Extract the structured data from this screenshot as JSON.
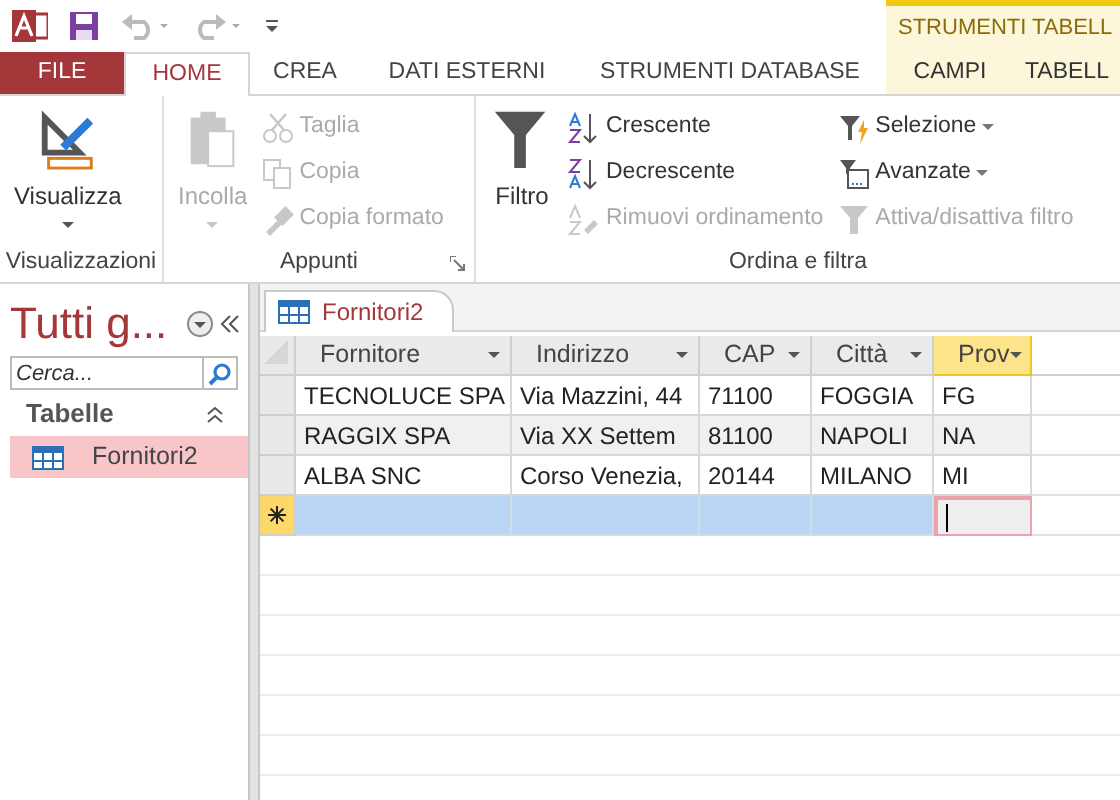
{
  "quick_access": {
    "undo_enabled": false,
    "redo_enabled": false
  },
  "contextual_group": {
    "label": "STRUMENTI TABELL"
  },
  "tabs": [
    {
      "label": "FILE",
      "kind": "file",
      "selected": false
    },
    {
      "label": "HOME",
      "kind": "tab",
      "selected": true
    },
    {
      "label": "CREA",
      "kind": "tab",
      "selected": false
    },
    {
      "label": "DATI ESTERNI",
      "kind": "tab",
      "selected": false
    },
    {
      "label": "STRUMENTI DATABASE",
      "kind": "tab",
      "selected": false
    },
    {
      "label": "CAMPI",
      "kind": "context",
      "selected": false
    },
    {
      "label": "TABELL",
      "kind": "context",
      "selected": false
    }
  ],
  "ribbon": {
    "groups": [
      {
        "label": "Visualizzazioni",
        "large": [
          {
            "label": "Visualizza",
            "disabled": false,
            "dropdown": true
          }
        ],
        "launcher": false
      },
      {
        "label": "Appunti",
        "large": [
          {
            "label": "Incolla",
            "disabled": true,
            "dropdown": true
          }
        ],
        "columns": [
          [
            {
              "label": "Taglia",
              "disabled": true,
              "dropdown": false
            },
            {
              "label": "Copia",
              "disabled": true,
              "dropdown": false
            },
            {
              "label": "Copia formato",
              "disabled": true,
              "dropdown": false
            }
          ]
        ],
        "launcher": true
      },
      {
        "label": "Ordina e filtra",
        "large": [
          {
            "label": "Filtro",
            "disabled": false,
            "dropdown": false
          }
        ],
        "columns": [
          [
            {
              "label": "Crescente",
              "disabled": false,
              "dropdown": false
            },
            {
              "label": "Decrescente",
              "disabled": false,
              "dropdown": false
            },
            {
              "label": "Rimuovi ordinamento",
              "disabled": true,
              "dropdown": false
            }
          ],
          [
            {
              "label": "Selezione",
              "disabled": false,
              "dropdown": true
            },
            {
              "label": "Avanzate",
              "disabled": false,
              "dropdown": true
            },
            {
              "label": "Attiva/disattiva filtro",
              "disabled": true,
              "dropdown": false
            }
          ]
        ],
        "launcher": false
      }
    ]
  },
  "nav_pane": {
    "title": "Tutti g...",
    "search": {
      "placeholder": "Cerca..."
    },
    "sections": [
      {
        "label": "Tabelle",
        "expanded": true,
        "items": [
          {
            "label": "Fornitori2",
            "selected": true
          }
        ]
      }
    ]
  },
  "document_tabs": [
    {
      "label": "Fornitori2",
      "selected": true
    }
  ],
  "table": {
    "columns": [
      {
        "label": "Fornitore",
        "selected": false
      },
      {
        "label": "Indirizzo",
        "selected": false
      },
      {
        "label": "CAP",
        "selected": false
      },
      {
        "label": "Città",
        "selected": false
      },
      {
        "label": "Prov",
        "selected": true
      }
    ],
    "rows": [
      {
        "cells": [
          "TECNOLUCE SPA",
          "Via Mazzini, 44",
          "71100",
          "FOGGIA",
          "FG"
        ]
      },
      {
        "cells": [
          "RAGGIX SPA",
          "Via XX Settem",
          "81100",
          "NAPOLI",
          "NA"
        ]
      },
      {
        "cells": [
          "ALBA SNC",
          "Corso Venezia,",
          "20144",
          "MILANO",
          "MI"
        ]
      }
    ],
    "new_row": {
      "selected": true,
      "cells": [
        {
          "focused": false
        },
        {
          "focused": false
        },
        {
          "focused": false
        },
        {
          "focused": false
        },
        {
          "focused": true
        }
      ]
    }
  }
}
